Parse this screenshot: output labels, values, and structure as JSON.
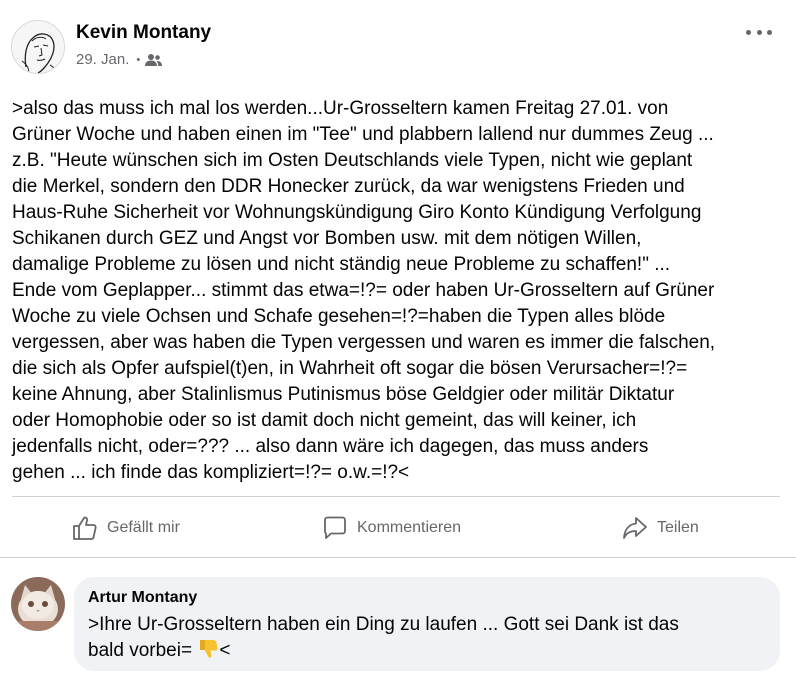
{
  "post": {
    "author": "Kevin Montany",
    "date": "29. Jan.",
    "separator": "•",
    "audience_icon": "friends-icon",
    "more_icon": "more-dots-icon",
    "body_lines": [
      ">also das muss ich mal los werden...Ur-Grosseltern kamen Freitag 27.01. von",
      "Grüner Woche und haben einen im \"Tee\" und plabbern lallend nur dummes Zeug ...",
      "z.B. \"Heute wünschen sich im Osten Deutschlands viele Typen, nicht wie geplant",
      "die Merkel, sondern den DDR Honecker zurück, da war wenigstens Frieden und",
      "Haus-Ruhe Sicherheit vor Wohnungskündigung Giro Konto Kündigung Verfolgung",
      "Schikanen durch GEZ und Angst vor Bomben usw. mit dem nötigen Willen,",
      "damalige Probleme zu lösen und nicht ständig neue Probleme zu schaffen!\" ...",
      "Ende vom Geplapper... stimmt das etwa=!?= oder haben Ur-Grosseltern auf Grüner",
      "Woche zu viele Ochsen und Schafe gesehen=!?=haben die Typen alles blöde",
      "vergessen, aber was haben die Typen vergessen und waren es immer die falschen,",
      "die sich als Opfer aufspiel(t)en, in Wahrheit oft sogar die bösen Verursacher=!?=",
      "keine Ahnung, aber Stalinlismus Putinismus böse Geldgier oder militär Diktatur",
      "oder Homophobie oder so ist damit doch nicht gemeint, das will keiner, ich",
      "jedenfalls nicht, oder=??? ... also dann wäre ich dagegen, das muss anders",
      "gehen ... ich finde das kompliziert=!?= o.w.=!?<"
    ]
  },
  "actions": {
    "like_label": "Gefällt mir",
    "comment_label": "Kommentieren",
    "share_label": "Teilen",
    "like_icon": "thumbs-up-icon",
    "comment_icon": "comment-bubble-icon",
    "share_icon": "share-arrow-icon"
  },
  "comment": {
    "author": "Artur Montany",
    "text_line_1": ">Ihre Ur-Grosseltern haben ein Ding zu laufen ... Gott sei Dank ist das",
    "text_line_2_before": "bald vorbei= ",
    "emoji": "thumbs-down-emoji",
    "text_line_2_after": "<"
  },
  "colors": {
    "secondary_text": "#65676b",
    "comment_bg": "#f0f2f5",
    "divider": "#ced0d4",
    "emoji_yellow": "#f7c230"
  }
}
